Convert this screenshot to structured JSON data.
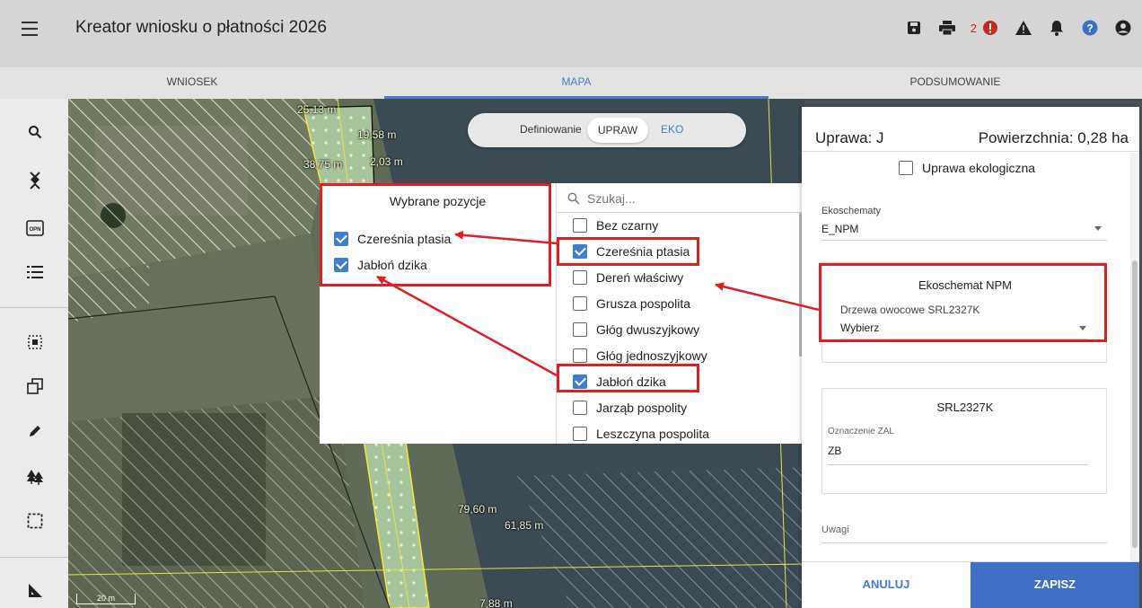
{
  "app": {
    "title": "Kreator wniosku o płatności 2026"
  },
  "topbar": {
    "error_count": "2",
    "icons": [
      "save-icon",
      "print-icon",
      "error-icon",
      "warning-icon",
      "bell-icon",
      "help-icon",
      "user-icon"
    ]
  },
  "tabs": [
    {
      "label": "WNIOSEK",
      "active": false
    },
    {
      "label": "MAPA",
      "active": true
    },
    {
      "label": "PODSUMOWANIE",
      "active": false
    }
  ],
  "toolbar": {
    "icons": [
      "search-icon",
      "plot-marker-icon",
      "opn-icon",
      "legend-list-icon",
      "select-area-icon",
      "copy-layers-icon",
      "edit-pencil-icon",
      "trees-icon",
      "dashed-select-icon",
      "measure-icon"
    ],
    "opn_label": "OPN"
  },
  "map": {
    "toggle": {
      "label": "Definiowanie",
      "upraw": "UPRAW",
      "eko": "EKO"
    },
    "labels": [
      "25,13 m",
      "19,58 m",
      "38,75 m",
      "2,03 m",
      "79,60 m",
      "61,85 m",
      "7,88 m"
    ],
    "scale": "20 m"
  },
  "multiselect": {
    "selected_title": "Wybrane pozycje",
    "selected": [
      "Czereśnia ptasia",
      "Jabłoń dzika"
    ],
    "search_placeholder": "Szukaj...",
    "options": [
      {
        "label": "Bez czarny",
        "checked": false
      },
      {
        "label": "Czereśnia ptasia",
        "checked": true
      },
      {
        "label": "Dereń właściwy",
        "checked": false
      },
      {
        "label": "Grusza pospolita",
        "checked": false
      },
      {
        "label": "Głóg dwuszyjkowy",
        "checked": false
      },
      {
        "label": "Głóg jednoszyjkowy",
        "checked": false
      },
      {
        "label": "Jabłoń dzika",
        "checked": true
      },
      {
        "label": "Jarząb pospolity",
        "checked": false
      },
      {
        "label": "Leszczyna pospolita",
        "checked": false
      }
    ]
  },
  "panel": {
    "crop": "Uprawa: J",
    "area": "Powierzchnia: 0,28 ha",
    "organic_label": "Uprawa ekologiczna",
    "ecoschemes_label": "Ekoschematy",
    "ecoschemes_value": "E_NPM",
    "npm_card_title": "Ekoschemat NPM",
    "npm_field_label": "Drzewa owocowe SRL2327K",
    "npm_field_value": "Wybierz",
    "srl_card_title": "SRL2327K",
    "zal_label": "Oznaczenie ZAL",
    "zal_value": "ZB",
    "notes_label": "Uwagi",
    "cancel": "ANULUJ",
    "save": "ZAPISZ"
  },
  "colors": {
    "accent": "#3f6fc5",
    "highlight": "#e01e25",
    "error": "#c62828"
  }
}
